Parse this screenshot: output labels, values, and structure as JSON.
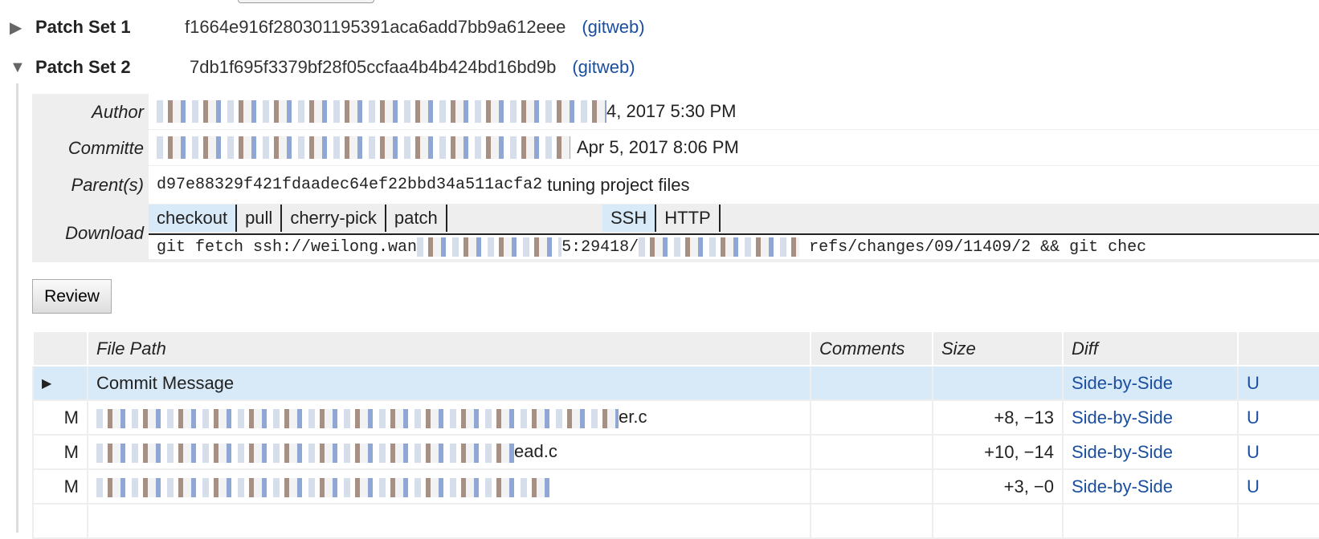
{
  "patch_sets": [
    {
      "label": "Patch Set 1",
      "hash": "f1664e916f280301195391aca6add7bb9a612eee",
      "link": "(gitweb)",
      "expanded": false
    },
    {
      "label": "Patch Set 2",
      "hash": "7db1f695f3379bf28f05ccfaa4b4b424bd16bd9b",
      "link": "(gitweb)",
      "expanded": true
    }
  ],
  "info": {
    "author_label": "Author",
    "author_value": "4, 2017 5:30 PM",
    "committer_label": "Committe",
    "committer_value": "Apr 5, 2017 8:06 PM",
    "parent_label": "Parent(s)",
    "parent_hash": "d97e88329f421fdaadec64ef22bbd34a511acfa2",
    "parent_subject": "tuning project files",
    "download_label": "Download",
    "download_tabs": [
      "checkout",
      "pull",
      "cherry-pick",
      "patch"
    ],
    "protocol_tabs": [
      "SSH",
      "HTTP"
    ],
    "command_start": "git fetch ssh://weilong.wan",
    "command_port": "5:29418/",
    "command_end": "refs/changes/09/11409/2 && git chec"
  },
  "review_button": "Review",
  "files": {
    "headers": [
      "",
      "File Path",
      "Comments",
      "Size",
      "Diff",
      ""
    ],
    "rows": [
      {
        "status": "",
        "path": "Commit Message",
        "comments": "",
        "size": "",
        "diff": "Side-by-Side",
        "unified": "U",
        "selected": true
      },
      {
        "status": "M",
        "path": "er.c",
        "comments": "",
        "size": "+8, −13",
        "diff": "Side-by-Side",
        "unified": "U"
      },
      {
        "status": "M",
        "path": "ead.c",
        "comments": "",
        "size": "+10, −14",
        "diff": "Side-by-Side",
        "unified": "U"
      },
      {
        "status": "M",
        "path": "",
        "comments": "",
        "size": "+3, −0",
        "diff": "Side-by-Side",
        "unified": "U"
      }
    ]
  }
}
